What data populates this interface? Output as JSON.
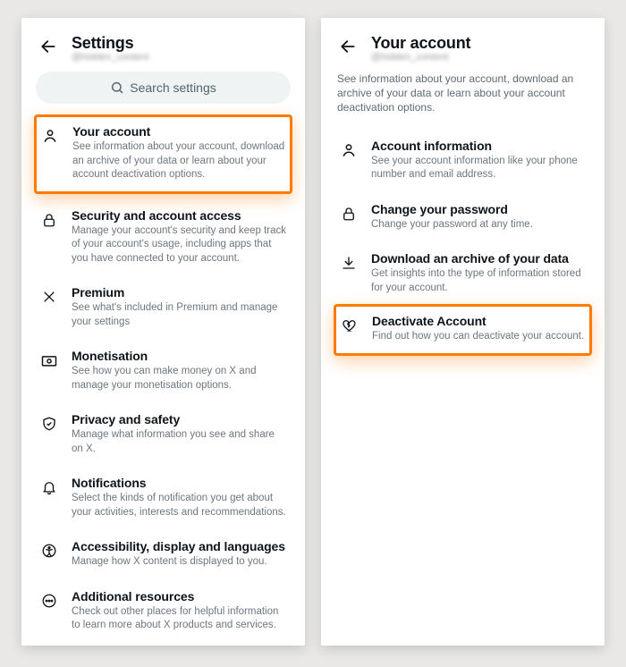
{
  "left": {
    "title": "Settings",
    "handle": "@hidden_content",
    "search_placeholder": "Search settings",
    "items": [
      {
        "title": "Your account",
        "sub": "See information about your account, download an archive of your data or learn about your account deactivation options."
      },
      {
        "title": "Security and account access",
        "sub": "Manage your account's security and keep track of your account's usage, including apps that you have connected to your account."
      },
      {
        "title": "Premium",
        "sub": "See what's included in Premium and manage your settings"
      },
      {
        "title": "Monetisation",
        "sub": "See how you can make money on X and manage your monetisation options."
      },
      {
        "title": "Privacy and safety",
        "sub": "Manage what information you see and share on X."
      },
      {
        "title": "Notifications",
        "sub": "Select the kinds of notification you get about your activities, interests and recommendations."
      },
      {
        "title": "Accessibility, display and languages",
        "sub": "Manage how X content is displayed to you."
      },
      {
        "title": "Additional resources",
        "sub": "Check out other places for helpful information to learn more about X products and services."
      }
    ]
  },
  "right": {
    "title": "Your account",
    "handle": "@hidden_content",
    "desc": "See information about your account, download an archive of your data or learn about your account deactivation options.",
    "items": [
      {
        "title": "Account information",
        "sub": "See your account information like your phone number and email address."
      },
      {
        "title": "Change your password",
        "sub": "Change your password at any time."
      },
      {
        "title": "Download an archive of your data",
        "sub": "Get insights into the type of information stored for your account."
      },
      {
        "title": "Deactivate Account",
        "sub": "Find out how you can deactivate your account."
      }
    ]
  }
}
